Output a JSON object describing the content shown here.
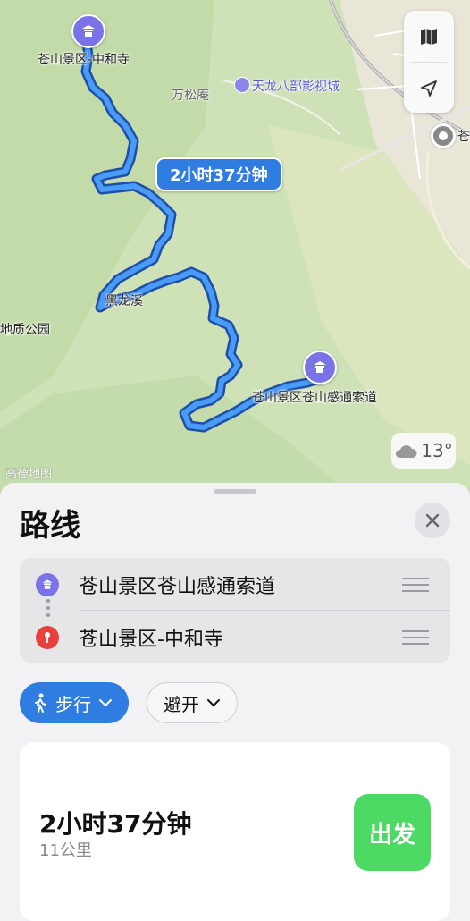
{
  "map": {
    "route_time_pill": "2小时37分钟",
    "labels": {
      "start_poi": "苍山景区-中和寺",
      "wansongan": "万松庵",
      "tianlong": "天龙八部影视城",
      "heilongxi": "黑龙溪",
      "geopark": "地质公园",
      "dest_poi": "苍山景区苍山感通索道",
      "cang_edge": "苍"
    },
    "weather_temp": "13°",
    "watermark": "高德地图",
    "colors": {
      "route": "#2f7de1",
      "poi": "#7a73e8",
      "terrain": "#cfe2b7",
      "urban": "#ece8dc"
    }
  },
  "sheet": {
    "title": "路线",
    "stops": [
      {
        "name": "苍山景区苍山感通索道",
        "icon": "pagoda-icon"
      },
      {
        "name": "苍山景区-中和寺",
        "icon": "pin-icon"
      }
    ],
    "mode_label": "步行",
    "avoid_label": "避开",
    "route": {
      "duration": "2小时37分钟",
      "distance": "11公里"
    },
    "go_label": "出发"
  }
}
